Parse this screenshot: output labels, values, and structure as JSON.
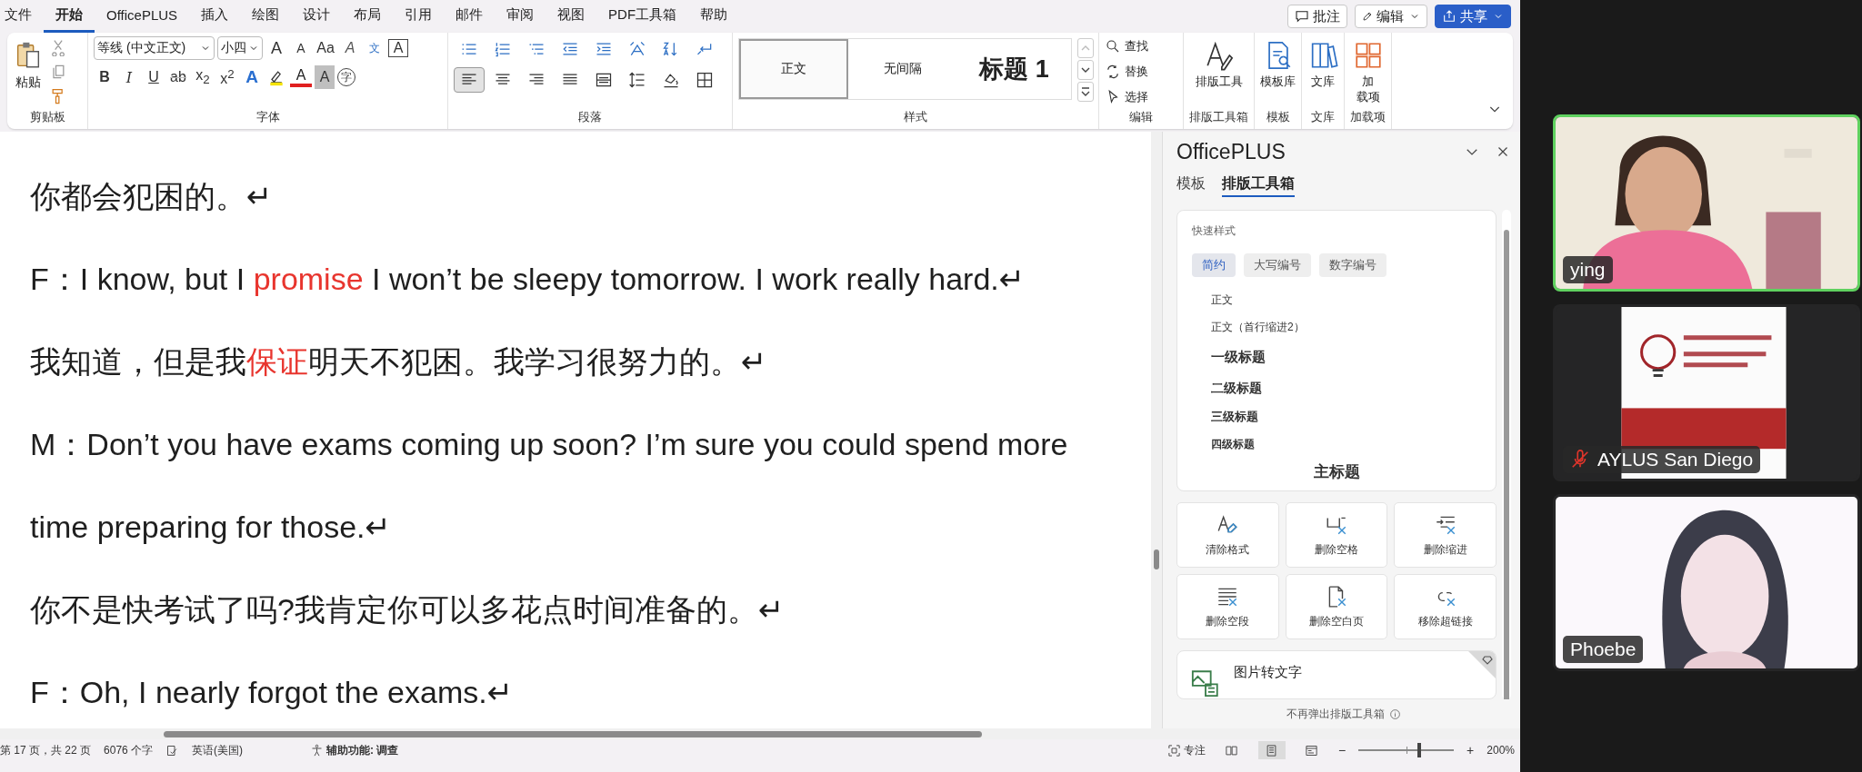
{
  "menu_tabs": [
    {
      "label": "文件",
      "selected": false
    },
    {
      "label": "开始",
      "selected": true
    },
    {
      "label": "OfficePLUS",
      "selected": false
    },
    {
      "label": "插入",
      "selected": false
    },
    {
      "label": "绘图",
      "selected": false
    },
    {
      "label": "设计",
      "selected": false
    },
    {
      "label": "布局",
      "selected": false
    },
    {
      "label": "引用",
      "selected": false
    },
    {
      "label": "邮件",
      "selected": false
    },
    {
      "label": "审阅",
      "selected": false
    },
    {
      "label": "视图",
      "selected": false
    },
    {
      "label": "PDF工具箱",
      "selected": false
    },
    {
      "label": "帮助",
      "selected": false
    }
  ],
  "top_buttons": [
    {
      "label": "批注",
      "kind": "comment"
    },
    {
      "label": "编辑",
      "kind": "edit"
    },
    {
      "label": "共享",
      "kind": "share"
    }
  ],
  "ribbon": {
    "clipboard": {
      "paste": "粘贴",
      "label": "剪贴板"
    },
    "font": {
      "name": "等线 (中文正文)",
      "size": "小四",
      "label": "字体",
      "row1": [
        {
          "kind": "grow",
          "text": "A"
        },
        {
          "kind": "shrink",
          "text": "A"
        },
        {
          "kind": "case",
          "text": "Aa"
        },
        {
          "kind": "clear",
          "text": "A"
        },
        {
          "kind": "phonetic",
          "text": "文"
        },
        {
          "kind": "boxed",
          "text": "A"
        }
      ],
      "row2": [
        {
          "kind": "bold",
          "text": "B"
        },
        {
          "kind": "italic",
          "text": "I"
        },
        {
          "kind": "underline",
          "text": "U"
        },
        {
          "kind": "strike",
          "text": "ab"
        },
        {
          "kind": "script",
          "text": "x$_{2}$"
        },
        {
          "kind": "script",
          "text": "x$^{2}$"
        },
        {
          "kind": "effect",
          "text": "A"
        },
        {
          "kind": "highlight"
        },
        {
          "kind": "fontcolor",
          "text": "A"
        },
        {
          "kind": "shade",
          "text": "A"
        },
        {
          "kind": "circled",
          "text": "字"
        }
      ]
    },
    "paragraph": {
      "label": "段落",
      "row1": [
        {
          "kind": "bullets"
        },
        {
          "kind": "numbering"
        },
        {
          "kind": "multilevel"
        },
        {
          "kind": "outdent"
        },
        {
          "kind": "indent"
        },
        {
          "kind": "direction"
        },
        {
          "kind": "sort"
        },
        {
          "kind": "paramark"
        }
      ],
      "row2": [
        {
          "kind": "align-left",
          "selected": true
        },
        {
          "kind": "align-center",
          "selected": false
        },
        {
          "kind": "align-right",
          "selected": false
        },
        {
          "kind": "justify",
          "selected": false
        },
        {
          "kind": "distribute",
          "selected": false
        },
        {
          "kind": "linespacing",
          "selected": false
        },
        {
          "kind": "shading",
          "selected": false
        },
        {
          "kind": "borders",
          "selected": false
        }
      ]
    },
    "styles": {
      "label": "样式",
      "items": [
        {
          "label": "正文",
          "kind": "normal",
          "selected": true
        },
        {
          "label": "无间隔",
          "kind": "normal",
          "selected": false
        },
        {
          "label": "标题 1",
          "kind": "heading",
          "selected": false
        }
      ]
    },
    "editing": {
      "label": "编辑",
      "items": [
        {
          "label": "查找",
          "kind": "search"
        },
        {
          "label": "替换",
          "kind": "replace"
        },
        {
          "label": "选择",
          "kind": "select"
        }
      ]
    },
    "big_groups": [
      {
        "button": "排版工具",
        "label": "排版工具箱",
        "kind": "typeset"
      },
      {
        "button": "模板库",
        "label": "模板",
        "kind": "templates"
      },
      {
        "button": "文库",
        "label": "文库",
        "kind": "library"
      },
      {
        "button": "加载项",
        "label": "加载项",
        "kind": "addins"
      }
    ]
  },
  "document": {
    "paragraphs": [
      {
        "segments": [
          {
            "text": "你都会犯困的。↵",
            "color": "#1f1f1f"
          }
        ]
      },
      {
        "segments": [
          {
            "text": "F：I know, but I ",
            "color": "#1f1f1f"
          },
          {
            "text": "promise",
            "color": "#e8352e"
          },
          {
            "text": " I won’t be sleepy tomorrow. I work really hard.↵",
            "color": "#1f1f1f"
          }
        ]
      },
      {
        "segments": [
          {
            "text": "我知道，但是我",
            "color": "#1f1f1f"
          },
          {
            "text": "保证",
            "color": "#e8352e"
          },
          {
            "text": "明天不犯困。我学习很努力的。↵",
            "color": "#1f1f1f"
          }
        ]
      },
      {
        "segments": [
          {
            "text": "M：Don’t you have exams coming up soon? I’m sure you could spend more time preparing for those.↵",
            "color": "#1f1f1f"
          }
        ]
      },
      {
        "segments": [
          {
            "text": "你不是快考试了吗?我肯定你可以多花点时间准备的。↵",
            "color": "#1f1f1f"
          }
        ]
      },
      {
        "segments": [
          {
            "text": "F：Oh, I nearly forgot the exams.↵",
            "color": "#1f1f1f"
          }
        ]
      }
    ]
  },
  "panel": {
    "title": "OfficePLUS",
    "tabs": [
      {
        "label": "模板",
        "selected": false
      },
      {
        "label": "排版工具箱",
        "selected": true
      }
    ],
    "quick_styles": {
      "title": "快速样式",
      "chips": [
        {
          "label": "简约",
          "selected": true
        },
        {
          "label": "大写编号",
          "selected": false
        },
        {
          "label": "数字编号",
          "selected": false
        }
      ],
      "items": [
        {
          "label": "正文",
          "kind": "body"
        },
        {
          "label": "正文（首行缩进2）",
          "kind": "body"
        },
        {
          "label": "一级标题",
          "kind": "h1"
        },
        {
          "label": "二级标题",
          "kind": "h2"
        },
        {
          "label": "三级标题",
          "kind": "h3"
        },
        {
          "label": "四级标题",
          "kind": "h4"
        },
        {
          "label": "主标题",
          "kind": "title"
        }
      ]
    },
    "tools": [
      {
        "label": "清除格式",
        "kind": "clear-format"
      },
      {
        "label": "删除空格",
        "kind": "delete-space"
      },
      {
        "label": "删除缩进",
        "kind": "delete-indent"
      },
      {
        "label": "删除空段",
        "kind": "delete-empty"
      },
      {
        "label": "删除空白页",
        "kind": "delete-page"
      },
      {
        "label": "移除超链接",
        "kind": "remove-link"
      }
    ],
    "feature": {
      "title": "图片转文字"
    },
    "footer": "不再弹出排版工具箱"
  },
  "status_bar": {
    "page": "第 17 页，共 22 页",
    "words": "6076 个字",
    "language": "英语(美国)",
    "accessibility": "辅助功能: 调查",
    "focus": "专注",
    "views": [
      {
        "kind": "read",
        "selected": false
      },
      {
        "kind": "print",
        "selected": true
      },
      {
        "kind": "web",
        "selected": false
      }
    ],
    "zoom_minus": "−",
    "zoom_plus": "+",
    "zoom": {
      "level": 0.64
    },
    "zoom_text": "200%"
  },
  "participants": [
    {
      "name": "ying",
      "active_speaker": true,
      "muted": false,
      "kind": "picture"
    },
    {
      "name": "AYLUS San Diego",
      "active_speaker": false,
      "muted": true,
      "kind": "picture"
    },
    {
      "name": "Phoebe",
      "active_speaker": false,
      "muted": false,
      "kind": "picture"
    }
  ]
}
